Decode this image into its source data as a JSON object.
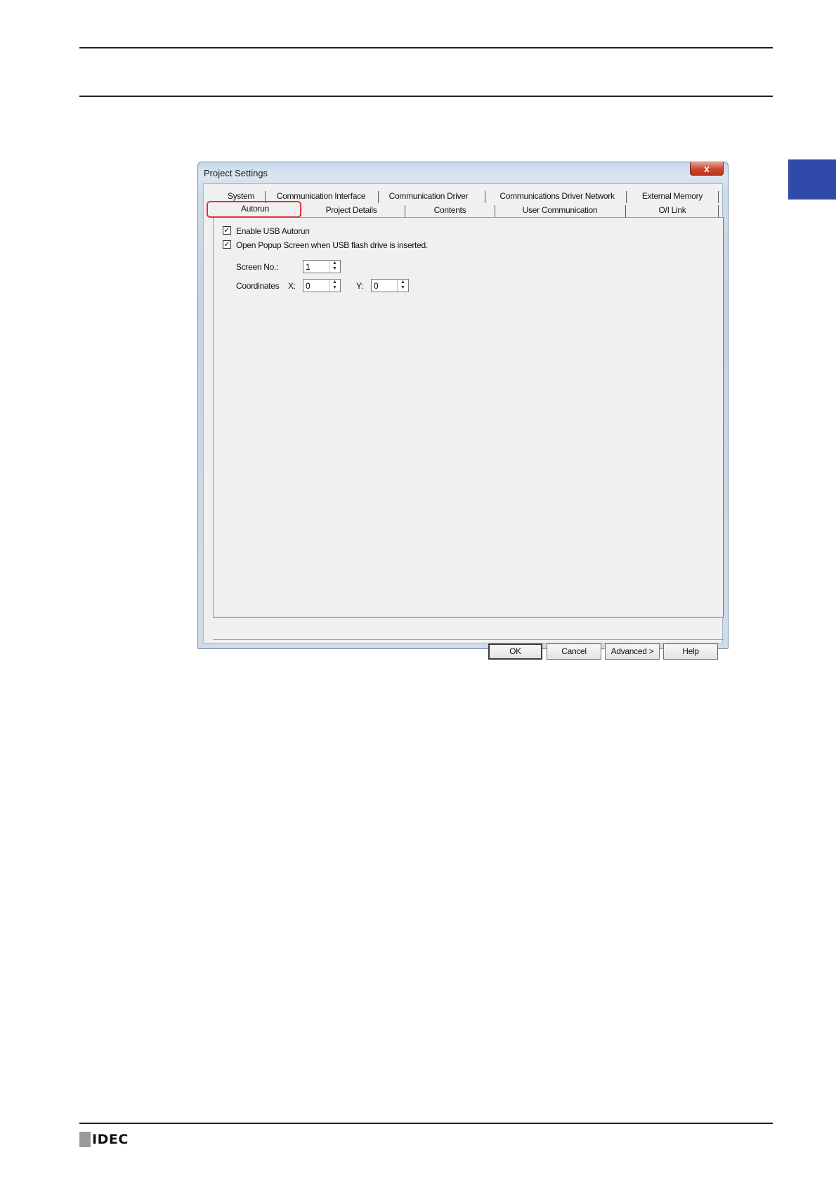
{
  "dialog": {
    "title": "Project Settings",
    "close_glyph": "x",
    "tabs_row1": [
      "System",
      "Communication Interface",
      "Communication Driver",
      "Communications Driver Network",
      "External Memory"
    ],
    "tabs_row2": [
      "Autorun",
      "Project Details",
      "Contents",
      "User Communication",
      "O/I Link"
    ],
    "active_tab": "Autorun",
    "options": {
      "enable_usb_autorun": {
        "label": "Enable USB Autorun",
        "checked": true
      },
      "open_popup": {
        "label": "Open Popup Screen when USB flash drive is inserted.",
        "checked": true
      }
    },
    "screen_no": {
      "label": "Screen No.:",
      "value": "1"
    },
    "coordinates": {
      "label": "Coordinates",
      "x_label": "X:",
      "x_value": "0",
      "y_label": "Y:",
      "y_value": "0"
    },
    "buttons": {
      "ok": "OK",
      "cancel": "Cancel",
      "advanced": "Advanced >",
      "help": "Help"
    }
  },
  "footer": {
    "logo": "IDEC"
  },
  "colors": {
    "side_tab": "#2f4aa8",
    "highlight": "#e0303a"
  }
}
